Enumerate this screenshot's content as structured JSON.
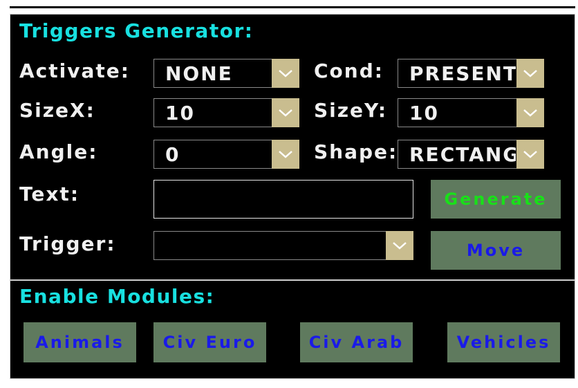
{
  "generator": {
    "title": "Triggers Generator:",
    "activate_label": "Activate:",
    "activate_value": "NONE",
    "cond_label": "Cond:",
    "cond_value": "PRESENT",
    "sizex_label": "SizeX:",
    "sizex_value": "10",
    "sizey_label": "SizeY:",
    "sizey_value": "10",
    "angle_label": "Angle:",
    "angle_value": "0",
    "shape_label": "Shape:",
    "shape_value": "RECTANGLE",
    "text_label": "Text:",
    "text_value": "",
    "trigger_label": "Trigger:",
    "trigger_value": "",
    "generate_label": "Generate",
    "move_label": "Move"
  },
  "modules": {
    "title": "Enable Modules:",
    "buttons": [
      "Animals",
      "Civ Euro",
      "Civ Arab",
      "Vehicles"
    ]
  },
  "colors": {
    "title_cyan": "#18e0e0",
    "dropdown_tan": "#c9bd8f",
    "button_green_bg": "#5f7a5e",
    "generate_text": "#19e019",
    "blue_text": "#1a1ae8"
  },
  "icons": {
    "dropdown": "chevron-down-icon"
  }
}
